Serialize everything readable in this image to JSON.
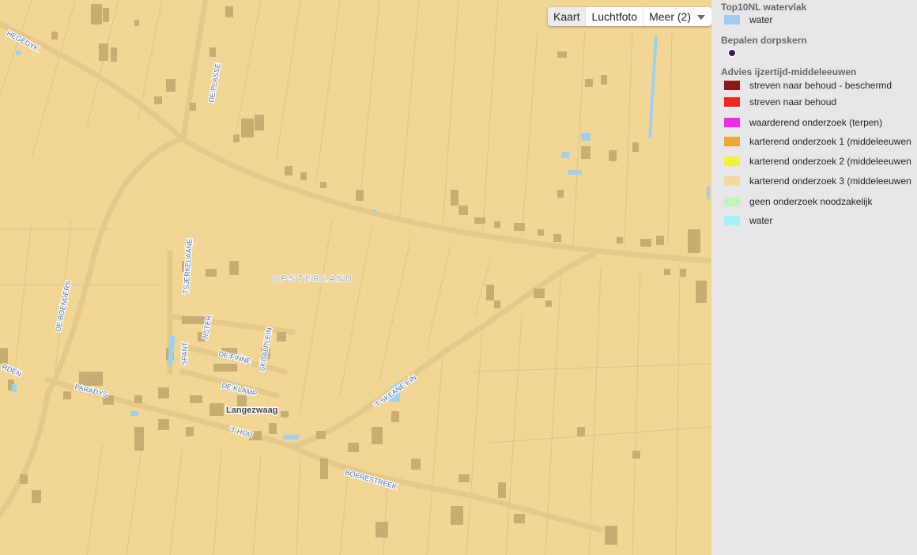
{
  "map": {
    "background": "#f2d696",
    "road_color": "#e6c98a",
    "building_color": "#c7ad72",
    "water_color": "#9fd1ef",
    "place_labels": {
      "village": "Langezwaag",
      "municipality": "O P S T E R L A N D"
    },
    "street_labels": {
      "hegedyk": "HEGEDYK",
      "de_plasse": "DE PLASSE",
      "de_boenders": "DE BOENDERS",
      "tsjerkelaane": "TSJERKELAANE",
      "jister": "JISTER",
      "spant": "SPANT",
      "de_finne": "DE FINNE",
      "skoalplein": "SKOALPLEIN",
      "de_klamp": "DE KLAMP",
      "paradys": "PARADYS",
      "t_hou": "'T HOU",
      "t_skeane_ein": "'T SKEANE EIN",
      "boerestreek": "BOERESTREEK",
      "rden": "RDEN"
    }
  },
  "map_type_control": {
    "options": [
      "Kaart",
      "Luchtfoto",
      "Meer (2)"
    ],
    "selected": "Kaart"
  },
  "legend": {
    "sections": [
      {
        "title": "Top10NL watervlak",
        "items": [
          {
            "label": "water",
            "color": "#a2cbef"
          }
        ]
      },
      {
        "title": "Bepalen dorpskern",
        "items": [
          {
            "label": "",
            "icon": "village-core-dot-icon",
            "color": "#3a1a6a"
          }
        ]
      },
      {
        "title": "Advies ijzertijd-middeleeuwen",
        "items": [
          {
            "label": "streven naar behoud - beschermd",
            "color": "#8b1a14"
          },
          {
            "label": "streven naar behoud",
            "color": "#ee2b1c"
          },
          {
            "label": "waarderend onderzoek (terpen)",
            "color": "#ee2be6"
          },
          {
            "label": "karterend onderzoek 1 (middeleeuwen",
            "color": "#eba934"
          },
          {
            "label": "karterend onderzoek 2 (middeleeuwen",
            "color": "#eef23a"
          },
          {
            "label": "karterend onderzoek 3 (middeleeuwen",
            "color": "#f2d99e"
          },
          {
            "label": "geen onderzoek noodzakelijk",
            "color": "#c4f2c0"
          },
          {
            "label": "water",
            "color": "#a4f2f4"
          }
        ]
      }
    ]
  }
}
